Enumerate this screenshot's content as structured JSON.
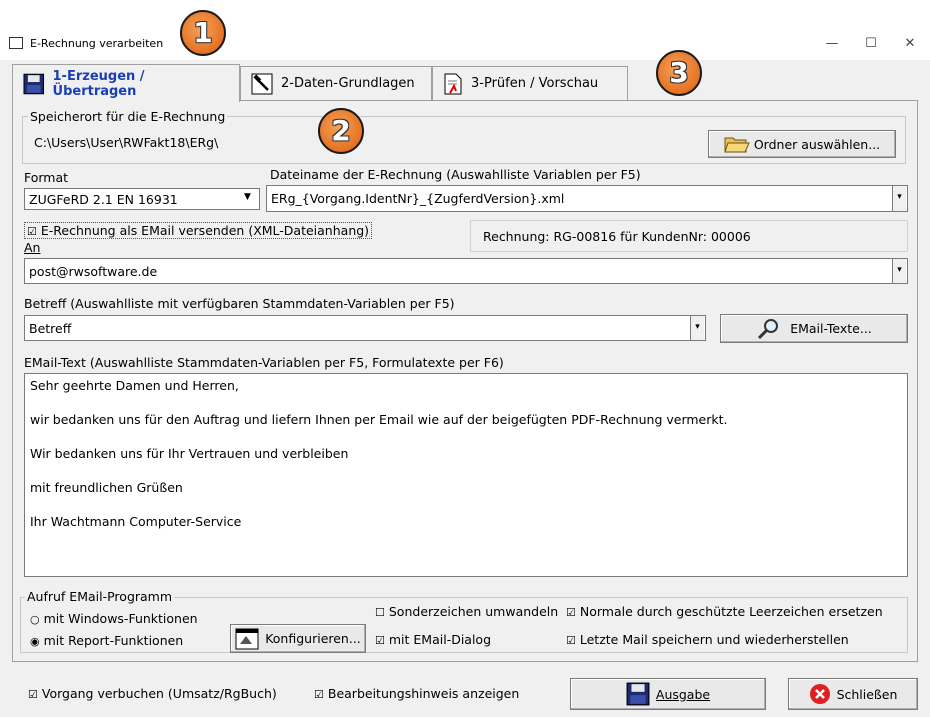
{
  "window": {
    "title": "E-Rechnung verarbeiten",
    "minimize": "—",
    "maximize": "☐",
    "close": "✕"
  },
  "badges": [
    "1",
    "2",
    "3"
  ],
  "tabs": [
    {
      "label": "1-Erzeugen / Übertragen",
      "icon": "floppy-disk-icon"
    },
    {
      "label": "2-Daten-Grundlagen",
      "icon": "hammer-icon"
    },
    {
      "label": "3-Prüfen / Vorschau",
      "icon": "document-icon"
    }
  ],
  "storage": {
    "group_label": "Speicherort für die E-Rechnung",
    "path": "C:\\Users\\User\\RWFakt18\\ERg\\",
    "choose_folder_button": "Ordner auswählen..."
  },
  "format": {
    "label": "Format",
    "value": "ZUGFeRD 2.1 EN 16931",
    "dropdown_arrow": "▼"
  },
  "filename": {
    "label": "Dateiname der E-Rechnung (Auswahlliste Variablen per F5)",
    "value": "ERg_{Vorgang.IdentNr}_{ZugferdVersion}.xml",
    "dropdown_arrow": "▾"
  },
  "email_send": {
    "checkbox": "☑",
    "label": "E-Rechnung als EMail versenden (XML-Dateianhang)",
    "invoice_info": "Rechnung: RG-00816 für KundenNr: 00006"
  },
  "to": {
    "label": "An",
    "value": "post@rwsoftware.de",
    "dropdown_arrow": "▾"
  },
  "subject": {
    "label": "Betreff (Auswahlliste mit verfügbaren Stammdaten-Variablen per F5)",
    "value": "Betreff",
    "dropdown_arrow": "▾",
    "email_texts_button": "EMail-Texte..."
  },
  "email_text": {
    "label": "EMail-Text (Auswahlliste Stammdaten-Variablen per F5, Formulatexte per F6)",
    "lines": [
      "Sehr geehrte Damen und Herren,",
      "wir bedanken uns für den Auftrag und liefern Ihnen per Email wie auf der beigefügten PDF-Rechnung vermerkt.",
      "Wir bedanken uns für Ihr Vertrauen und verbleiben",
      "mit freundlichen Grüßen",
      "Ihr Wachtmann Computer-Service"
    ]
  },
  "email_program": {
    "group_label": "Aufruf EMail-Programm",
    "radio_windows": "mit Windows-Funktionen",
    "radio_report": "mit Report-Funktionen",
    "radio_windows_mark": "○",
    "radio_report_mark": "◉",
    "configure_button": "Konfigurieren...",
    "special_chars": "Sonderzeichen umwandeln",
    "special_chars_mark": "☐",
    "email_dialog": "mit EMail-Dialog",
    "email_dialog_mark": "☑",
    "nbsp": "Normale durch geschützte Leerzeichen ersetzen",
    "nbsp_mark": "☑",
    "save_last": "Letzte Mail speichern und wiederherstellen",
    "save_last_mark": "☑"
  },
  "footer": {
    "book": "Vorgang verbuchen (Umsatz/RgBuch)",
    "book_mark": "☑",
    "hint": "Bearbeitungshinweis anzeigen",
    "hint_mark": "☑",
    "output_button": "Ausgabe",
    "close_button": "Schließen"
  }
}
